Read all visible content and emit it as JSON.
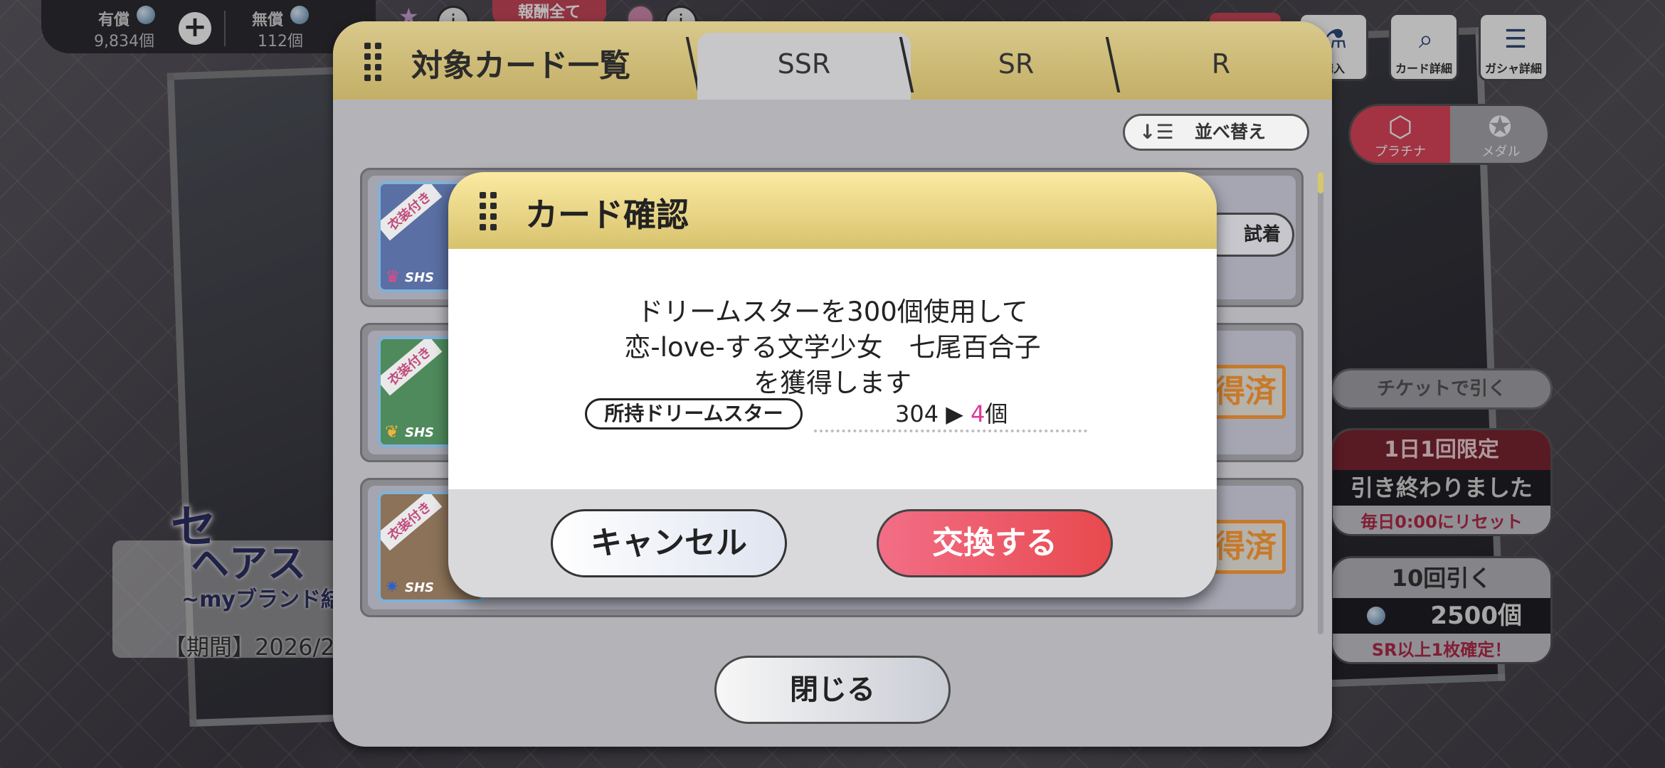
{
  "currency": {
    "paid_label": "有償",
    "paid_value": "9,834個",
    "free_label": "無償",
    "free_value": "112個"
  },
  "top_tab_partial": "報酬全て",
  "menu": {
    "buy_label": "購入",
    "card_detail_label": "カード詳細",
    "gacha_detail_label": "ガシャ詳細"
  },
  "gacha_toggle": {
    "platinum_label": "プラチナ",
    "medal_label": "メダル"
  },
  "draw": {
    "ticket_label": "チケットで引く",
    "daily_limit_label": "1日1回限定",
    "daily_done_label": "引き終わりました",
    "daily_reset_label": "毎日0:00にリセット",
    "ten_draw_label": "10回引く",
    "ten_draw_cost": "2500個",
    "ten_draw_note": "SR以上1枚確定！"
  },
  "banner": {
    "title_fragment": "セ",
    "subtitle_fragment": "ヘアス",
    "brand_fragment": "~myブランド結",
    "period_fragment": "【期間】2026/2"
  },
  "card_list": {
    "title": "対象カード一覧",
    "tabs": [
      "SSR",
      "SR",
      "R"
    ],
    "active_tab": "SSR",
    "sort_label": "並べ替え",
    "rows": [
      {
        "badge": "衣装付き",
        "rank": "SHS",
        "action": "試着",
        "action_type": "tryon",
        "thumb_color": "#5a6fa3"
      },
      {
        "badge": "衣装付き",
        "rank": "SHS",
        "action": "得済",
        "action_type": "obtained",
        "thumb_color": "#4e8a5c"
      },
      {
        "badge": "衣装付き",
        "rank": "SHS",
        "action": "得済",
        "action_type": "obtained",
        "thumb_color": "#8b7258"
      }
    ],
    "close_label": "閉じる"
  },
  "dialog": {
    "title": "カード確認",
    "message_line1": "ドリームスターを300個使用して",
    "message_line2": "恋-love-する文学少女　七尾百合子",
    "message_line3": "を獲得します",
    "owned_label": "所持ドリームスター",
    "owned_before": "304 ▶ ",
    "owned_after": "4",
    "owned_unit": "個",
    "cancel_label": "キャンセル",
    "confirm_label": "交換する"
  },
  "colors": {
    "accent_gold": "#d7c26d",
    "confirm_red": "#e8494e",
    "highlight_pink": "#e0379a"
  }
}
